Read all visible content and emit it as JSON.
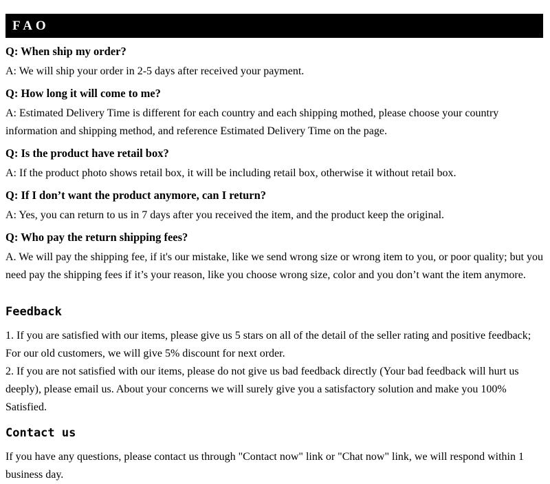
{
  "banner": {
    "title": "FAQ",
    "display_title": "FAO",
    "background_color": "#000000",
    "text_color": "#ffffff"
  },
  "faq": {
    "items": [
      {
        "question": "Q: When ship my order?",
        "answer": "A: We will ship your order in 2-5 days after received your payment."
      },
      {
        "question": "Q: How long it will come to me?",
        "answer": "A: Estimated Delivery Time is different for each country and each shipping mothed, please choose your country information and shipping method, and reference Estimated Delivery Time on the page."
      },
      {
        "question": "Q: Is the product have retail box?",
        "answer": "A: If  the product photo shows retail box, it will be including retail box, otherwise it without retail box."
      },
      {
        "question": "Q: If I don’t want the product anymore, can I return?",
        "answer": "A: Yes, you can return to us in 7 days after you received the item, and the product keep the original."
      },
      {
        "question": "Q: Who pay the return shipping fees?",
        "answer": "A. We will pay the shipping fee, if  it's our mistake, like we send wrong size or wrong item to you, or poor quality; but you need pay the shipping fees if  it’s your reason, like you choose wrong size, color and you don’t want the item anymore."
      }
    ]
  },
  "feedback": {
    "heading": "Feedback",
    "items": [
      "1.  If you are satisfied with our items, please give us 5 stars on all of the detail of the seller rating and positive feedback; For our old customers, we will give 5% discount for next order.",
      "2.  If you are not satisfied with our items, please do not give us bad feedback directly (Your bad feedback will hurt us deeply), please email us. About your concerns we will surely give you a satisfactory solution and make you 100% Satisfied."
    ]
  },
  "contact": {
    "heading": "Contact us",
    "body": "If you have any questions, please contact us through \"Contact now\" link or \"Chat now\" link, we will respond within 1 business day."
  },
  "colors": {
    "page_background": "#ffffff",
    "text": "#000000",
    "banner": "#000000"
  }
}
